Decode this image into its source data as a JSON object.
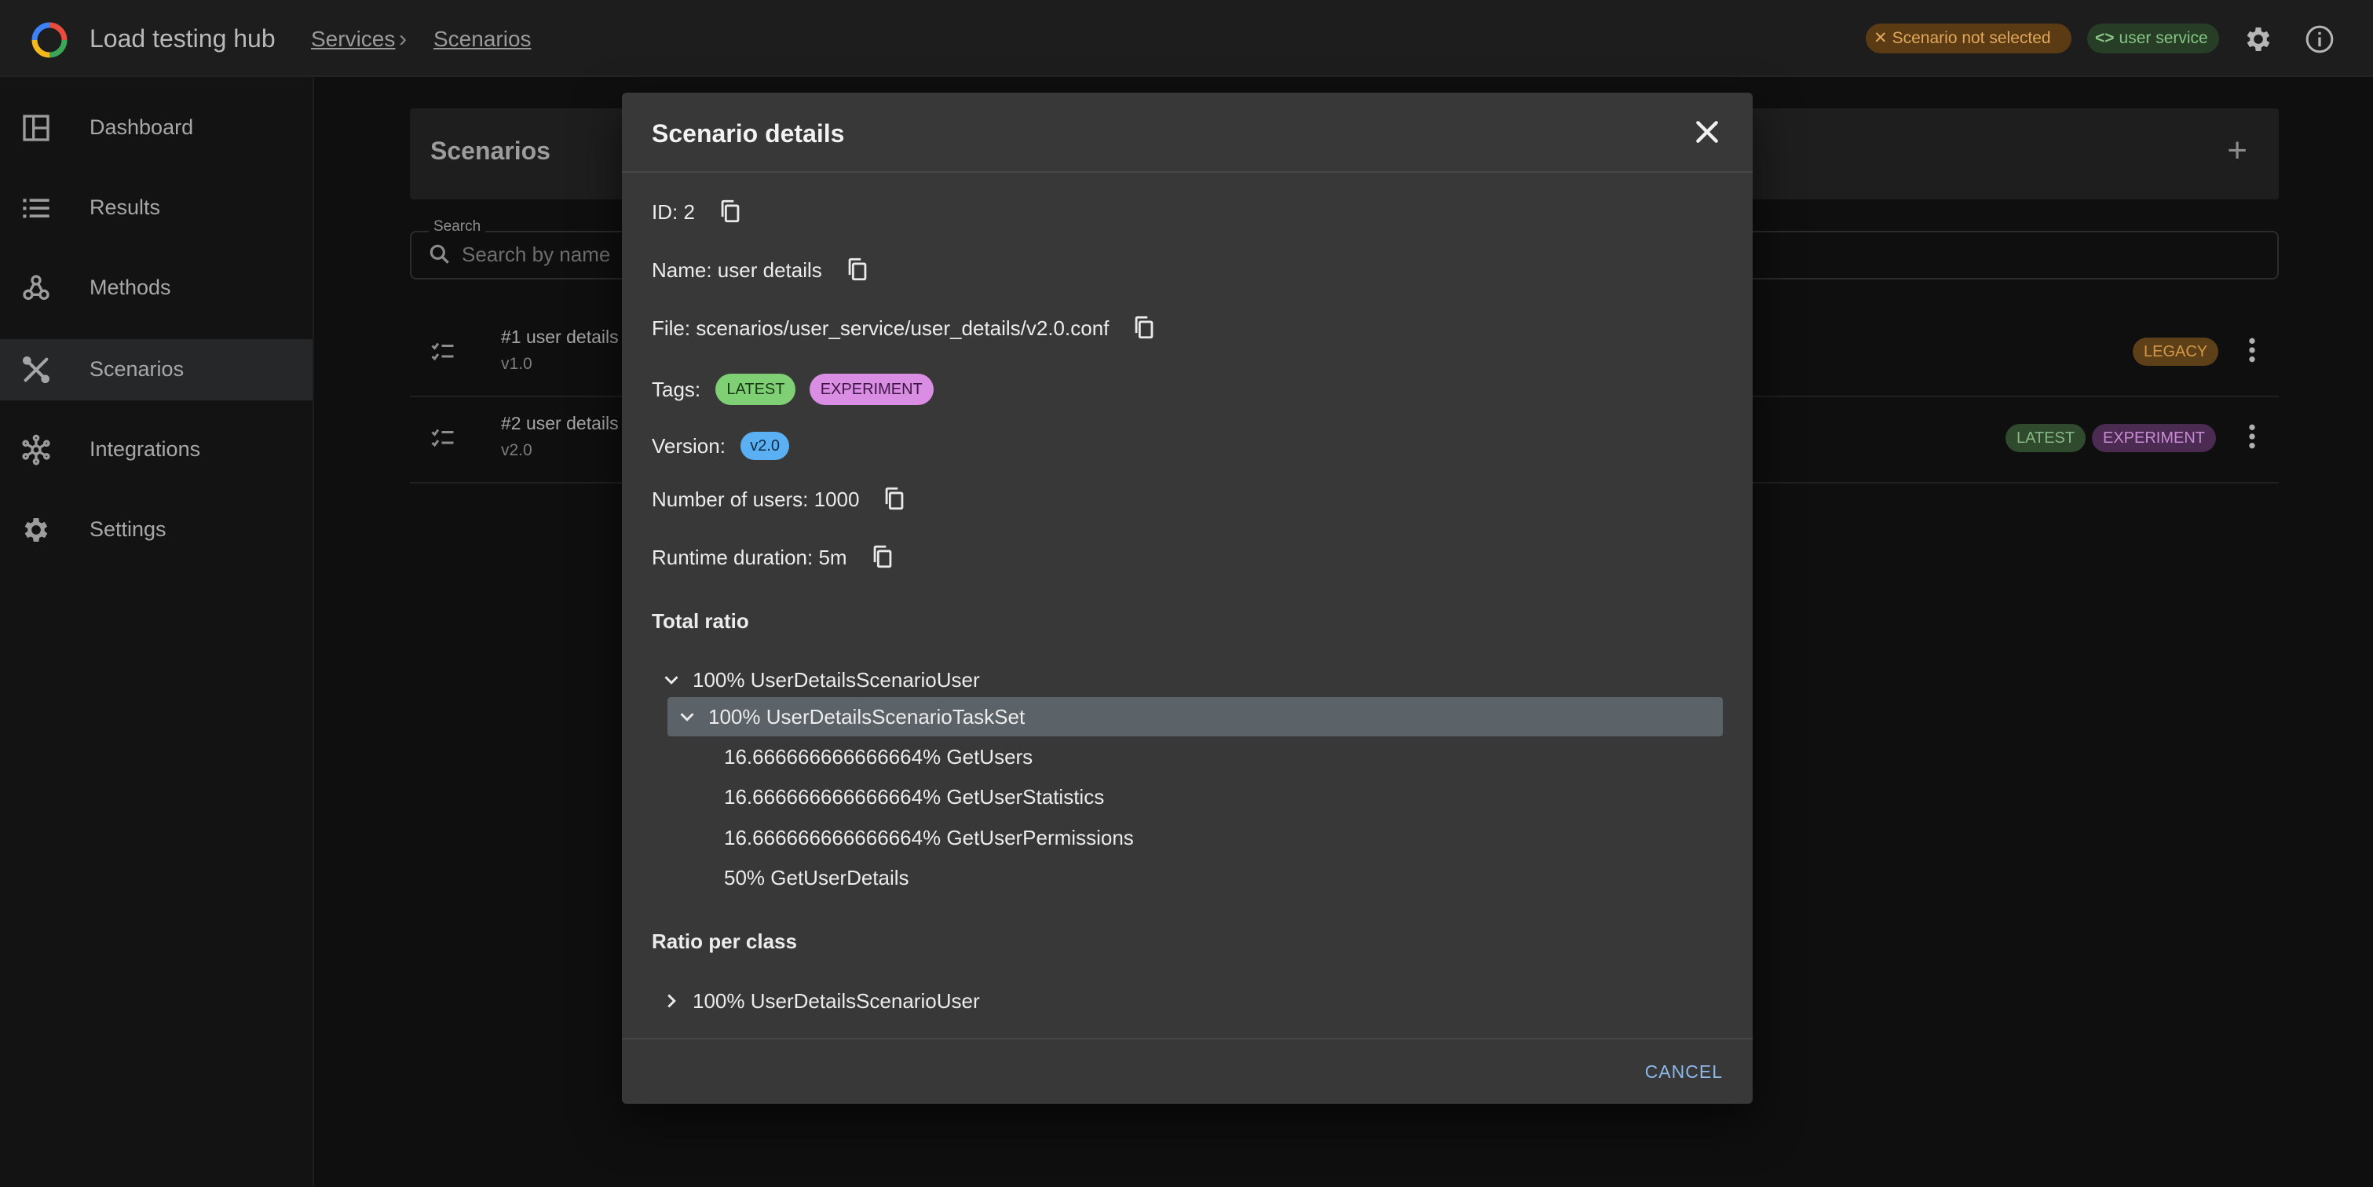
{
  "header": {
    "app_title": "Load testing hub",
    "breadcrumbs": [
      "Services",
      "Scenarios"
    ],
    "scenario_status": "Scenario not selected",
    "service_chip": "user service",
    "icons": [
      "app-logo-icon",
      "wrench-icon",
      "code-icon",
      "gear-icon",
      "info-icon"
    ]
  },
  "sidebar": {
    "items": [
      {
        "label": "Dashboard",
        "icon": "dashboard-icon"
      },
      {
        "label": "Results",
        "icon": "list-icon"
      },
      {
        "label": "Methods",
        "icon": "webhook-icon"
      },
      {
        "label": "Scenarios",
        "icon": "wrench-icon",
        "active": true
      },
      {
        "label": "Integrations",
        "icon": "hub-icon"
      },
      {
        "label": "Settings",
        "icon": "gear-icon"
      }
    ]
  },
  "main": {
    "title": "Scenarios",
    "search_label": "Search",
    "search_placeholder": "Search by name",
    "rows": [
      {
        "title": "#1 user details",
        "version": "v1.0",
        "tags": [
          "LEGACY"
        ]
      },
      {
        "title": "#2 user details",
        "version": "v2.0",
        "tags": [
          "LATEST",
          "EXPERIMENT"
        ]
      }
    ]
  },
  "dialog": {
    "title": "Scenario details",
    "id": "ID: 2",
    "name": "Name: user details",
    "file": "File: scenarios/user_service/user_details/v2.0.conf",
    "tags_label": "Tags:",
    "tags": [
      "LATEST",
      "EXPERIMENT"
    ],
    "version_label": "Version:",
    "version": "v2.0",
    "users": "Number of users: 1000",
    "runtime": "Runtime duration: 5m",
    "total_ratio_title": "Total ratio",
    "total_ratio": {
      "root": "100% UserDetailsScenarioUser",
      "taskset": "100% UserDetailsScenarioTaskSet",
      "tasks": [
        "16.666666666666664% GetUsers",
        "16.666666666666664% GetUserStatistics",
        "16.666666666666664% GetUserPermissions",
        "50% GetUserDetails"
      ]
    },
    "ratio_per_class_title": "Ratio per class",
    "ratio_per_class_root": "100% UserDetailsScenarioUser",
    "cancel_label": "CANCEL"
  },
  "colors": {
    "warn_chip": "#5a3b13",
    "service_chip": "#273d26",
    "latest_tag": "#7fd075",
    "experiment_tag": "#d98ee4",
    "version_tag": "#5ab0f2",
    "selected_tree_row": "#5b6268",
    "link_button": "#8cb8ea"
  }
}
